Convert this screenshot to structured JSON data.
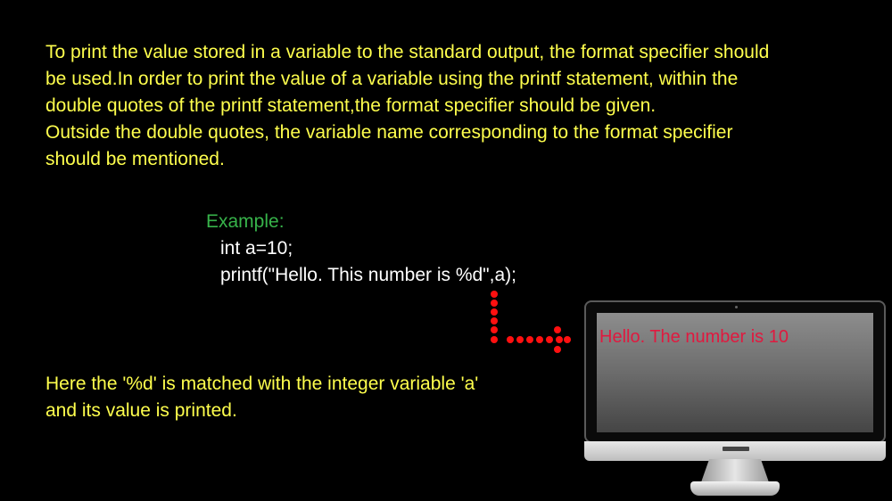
{
  "intro": {
    "lines": [
      "To print the value stored in a variable to the standard output, the format specifier should",
      "be used.In order to print the value of a variable using the printf statement, within the",
      "double quotes of the printf statement,the format specifier should be given.",
      "Outside the double quotes, the variable name corresponding to the format specifier",
      "should be mentioned."
    ]
  },
  "example": {
    "heading": "Example:",
    "code": [
      "int a=10;",
      "printf(\"Hello. This number is %d\",a);"
    ]
  },
  "explanation": {
    "lines": [
      "Here the '%d' is matched with the integer variable 'a'",
      "and its value is printed."
    ]
  },
  "monitor": {
    "output_text": "Hello. The number is 10"
  },
  "colors": {
    "background": "#000000",
    "body_text": "#ffff4d",
    "example_heading": "#37b34a",
    "code_text": "#ffffff",
    "arrow": "#ff1010",
    "output_text": "#e0193f"
  },
  "icons": {
    "arrow": "dotted-arrow-icon",
    "monitor": "monitor-icon"
  }
}
